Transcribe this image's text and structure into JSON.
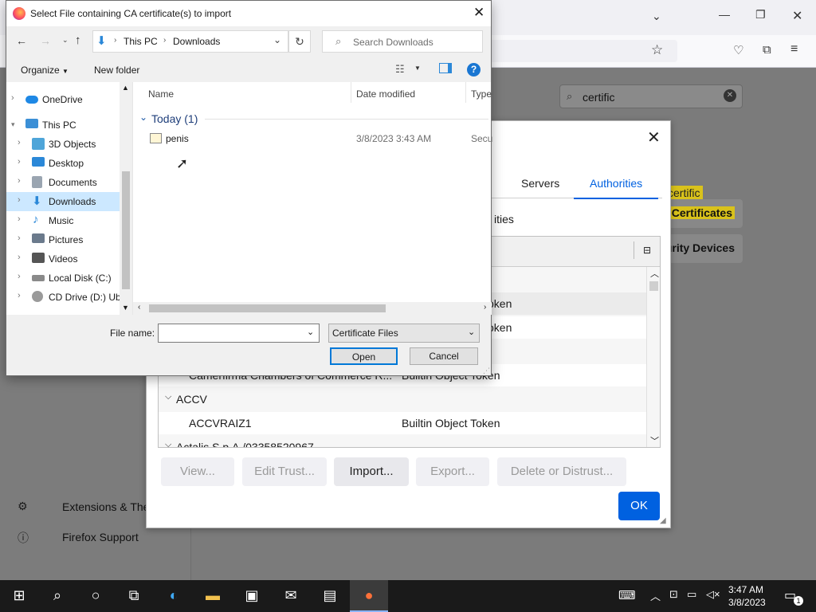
{
  "firefox": {
    "search_value": "certific",
    "sidebar": {
      "extensions": "Extensions & Themes",
      "support": "Firefox Support"
    },
    "buttons_right": {
      "certs": "Certificates...",
      "devices": "Security Devices...",
      "highlight": "certific"
    }
  },
  "cert_manager": {
    "tabs": [
      "Servers",
      "Authorities"
    ],
    "section_partial": "ities",
    "rows": [
      {
        "name": "",
        "token": "Token",
        "alt": false
      },
      {
        "name": "",
        "token": "Token",
        "alt": true
      },
      {
        "name": "Camerfirma Chambers of Commerce R...",
        "token": "Builtin Object Token",
        "alt": true
      },
      {
        "name": "ACCV",
        "token": "",
        "group": true
      },
      {
        "name": "ACCVRAIZ1",
        "token": "Builtin Object Token",
        "alt": true
      },
      {
        "name": "Actalis S.p.A./03358520967",
        "token": "",
        "group": true
      }
    ],
    "buttons": {
      "view": "View...",
      "edit": "Edit Trust...",
      "import": "Import...",
      "export": "Export...",
      "delete": "Delete or Distrust...",
      "ok": "OK"
    }
  },
  "file_dialog": {
    "title": "Select File containing CA certificate(s) to import",
    "breadcrumb": [
      "This PC",
      "Downloads"
    ],
    "search_placeholder": "Search Downloads",
    "organize": "Organize",
    "new_folder": "New folder",
    "nav": [
      {
        "label": "OneDrive",
        "color": "#1e88e5",
        "selected": false
      },
      {
        "label": "This PC",
        "color": "#3b8fd6",
        "selected": false
      },
      {
        "label": "3D Objects",
        "color": "#4ea5d9",
        "selected": false
      },
      {
        "label": "Desktop",
        "color": "#2b88d8",
        "selected": false
      },
      {
        "label": "Documents",
        "color": "#9aa5b1",
        "selected": false
      },
      {
        "label": "Downloads",
        "color": "#2b88d8",
        "selected": true
      },
      {
        "label": "Music",
        "color": "#2b88d8",
        "selected": false
      },
      {
        "label": "Pictures",
        "color": "#6b7a8c",
        "selected": false
      },
      {
        "label": "Videos",
        "color": "#555",
        "selected": false
      },
      {
        "label": "Local Disk (C:)",
        "color": "#8a8a8a",
        "selected": false
      },
      {
        "label": "CD Drive (D:) Ub",
        "color": "#9a9a9a",
        "selected": false
      }
    ],
    "columns": [
      "Name",
      "Date modified",
      "Type"
    ],
    "group_label": "Today (1)",
    "files": [
      {
        "name": "penis",
        "date": "3/8/2023 3:43 AM",
        "type": "Secu"
      }
    ],
    "file_name_label": "File name:",
    "file_name_value": "",
    "filter": "Certificate Files",
    "open": "Open",
    "cancel": "Cancel"
  },
  "taskbar": {
    "time": "3:47 AM",
    "date": "3/8/2023",
    "notif_count": "1"
  }
}
